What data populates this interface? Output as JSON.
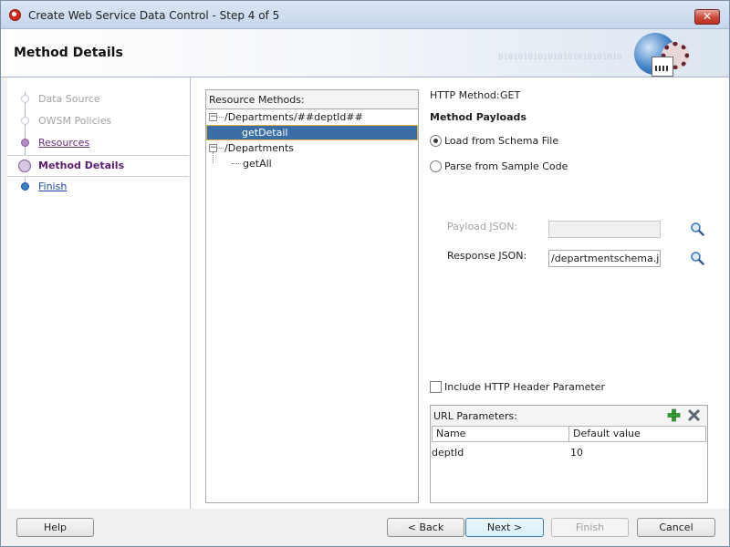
{
  "window": {
    "title": "Create Web Service Data Control - Step 4 of 5",
    "close_glyph": "✕"
  },
  "header": {
    "page_title": "Method Details",
    "banner_text": "0101010101010101010101010"
  },
  "nav": {
    "items": [
      {
        "label": "Data Source",
        "state": "disabled"
      },
      {
        "label": "OWSM Policies",
        "state": "disabled"
      },
      {
        "label": "Resources",
        "state": "visited"
      },
      {
        "label": "Method Details",
        "state": "current"
      },
      {
        "label": "Finish",
        "state": "next"
      }
    ]
  },
  "resources": {
    "title": "Resource Methods:",
    "tree": [
      {
        "label": "/Departments/##deptId##",
        "level": 0,
        "expanded": true
      },
      {
        "label": "getDetail",
        "level": 1,
        "selected": true
      },
      {
        "label": "/Departments",
        "level": 0,
        "expanded": true
      },
      {
        "label": "getAll",
        "level": 1
      }
    ],
    "expander_glyph": "−"
  },
  "details": {
    "http_method_label": "HTTP Method:",
    "http_method_value": "GET",
    "payloads_heading": "Method Payloads",
    "radio_schema": "Load from Schema File",
    "radio_sample": "Parse from Sample Code",
    "selected_option": "schema",
    "payload_json_label": "Payload JSON:",
    "payload_json_value": "",
    "response_json_label": "Response JSON:",
    "response_json_value": "/departmentschema.json",
    "include_header_label": "Include HTTP Header Parameter",
    "include_header_checked": false
  },
  "url_params": {
    "title": "URL Parameters:",
    "columns": [
      "Name",
      "Default value"
    ],
    "rows": [
      {
        "name": "deptId",
        "default": "10"
      }
    ]
  },
  "buttons": {
    "help": "Help",
    "back": "< Back",
    "next": "Next >",
    "finish": "Finish",
    "cancel": "Cancel"
  },
  "colors": {
    "selection": "#3a6ea5",
    "current_step": "#5a1d6c",
    "link": "#1d4aa0"
  }
}
